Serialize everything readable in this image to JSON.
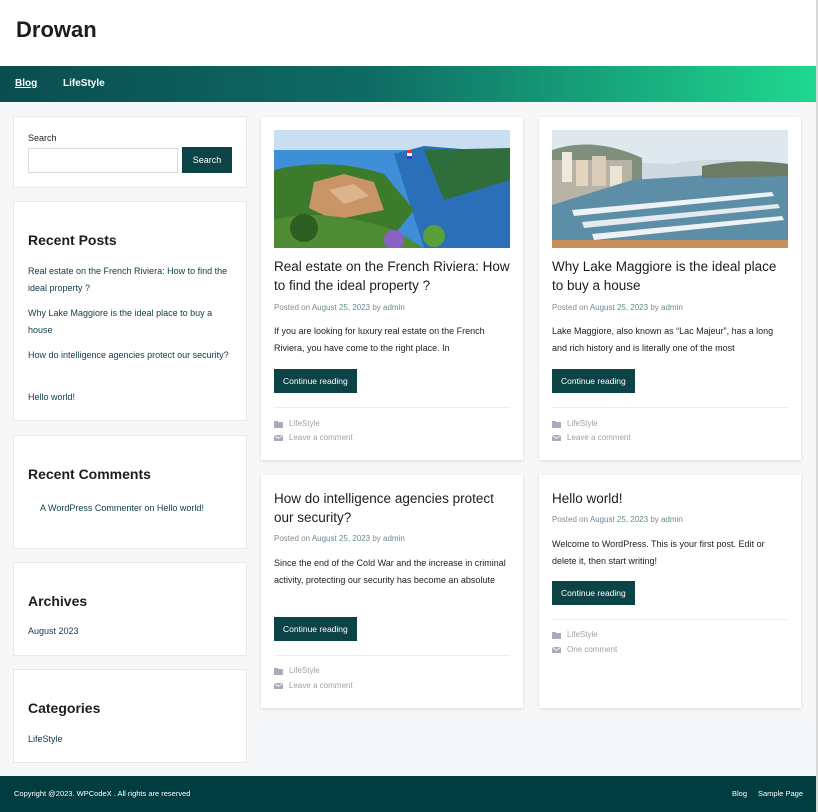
{
  "site": {
    "title": "Drowan"
  },
  "nav": {
    "items": [
      {
        "label": "Blog"
      },
      {
        "label": "LifeStyle"
      }
    ]
  },
  "sidebar": {
    "search": {
      "label": "Search",
      "button": "Search",
      "placeholder": ""
    },
    "recent_posts": {
      "title": "Recent Posts",
      "items": [
        "Real estate on the French Riviera: How to find the ideal property ?",
        "Why Lake Maggiore is the ideal place to buy a house",
        "How do intelligence agencies protect our security?",
        "Hello world!"
      ]
    },
    "recent_comments": {
      "title": "Recent Comments",
      "author": "A WordPress Commenter",
      "on": "on",
      "post": "Hello world!"
    },
    "archives": {
      "title": "Archives",
      "items": [
        "August 2023"
      ]
    },
    "categories": {
      "title": "Categories",
      "items": [
        "LifeStyle"
      ]
    }
  },
  "posts": [
    {
      "title": "Real estate on the French Riviera: How to find the ideal property ?",
      "posted_on": "Posted on",
      "date": "August 25, 2023",
      "by": "by",
      "author": "admin",
      "excerpt": "If you are looking for luxury real estate on the French Riviera, you have come to the right place. In",
      "button": "Continue reading",
      "category": "LifeStyle",
      "comments": "Leave a comment",
      "image": "riviera-coast-photo"
    },
    {
      "title": "Why Lake Maggiore is the ideal place to buy a house",
      "posted_on": "Posted on",
      "date": "August 25, 2023",
      "by": "by",
      "author": "admin",
      "excerpt": "Lake Maggiore, also known as “Lac Majeur”, has a long and rich history and is literally one of the most",
      "button": "Continue reading",
      "category": "LifeStyle",
      "comments": "Leave a comment",
      "image": "harbor-marina-photo"
    },
    {
      "title": "How do intelligence agencies protect our security?",
      "posted_on": "Posted on",
      "date": "August 25, 2023",
      "by": "by",
      "author": "admin",
      "excerpt": "Since the end of the Cold War and the increase in criminal activity, protecting our security has become an absolute",
      "button": "Continue reading",
      "category": "LifeStyle",
      "comments": "Leave a comment"
    },
    {
      "title": "Hello world!",
      "posted_on": "Posted on",
      "date": "August 25, 2023",
      "by": "by",
      "author": "admin",
      "excerpt": "Welcome to WordPress. This is your first post. Edit or delete it, then start writing!",
      "button": "Continue reading",
      "category": "LifeStyle",
      "comments": "One comment"
    }
  ],
  "footer": {
    "copyright": "Copyright @2023. WPCodeX . All rights are reserved",
    "links": [
      "Blog",
      "Sample Page"
    ]
  },
  "colors": {
    "primary": "#0c4347",
    "footer_bg": "#003d40",
    "gradient_start": "#0b4d4f",
    "gradient_end": "#1fd88f"
  }
}
